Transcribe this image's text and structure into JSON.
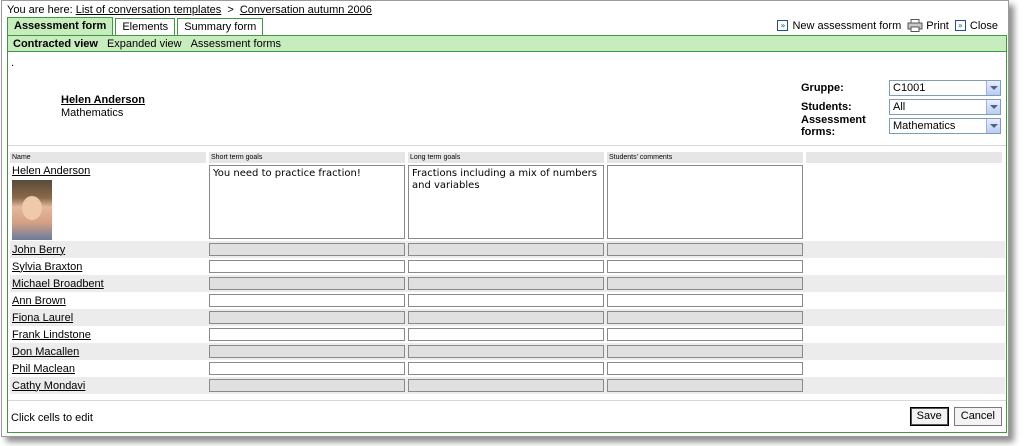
{
  "breadcrumb": {
    "prefix": "You are here:",
    "items": [
      "List of conversation templates",
      "Conversation autumn 2006"
    ],
    "separator": ">"
  },
  "tabs": [
    {
      "label": "Assessment form",
      "active": true
    },
    {
      "label": "Elements",
      "active": false
    },
    {
      "label": "Summary form",
      "active": false
    }
  ],
  "top_actions": {
    "new_form": "New assessment form",
    "print": "Print",
    "close": "Close"
  },
  "subnav": [
    {
      "label": "Contracted view",
      "active": true
    },
    {
      "label": "Expanded view",
      "active": false
    },
    {
      "label": "Assessment forms",
      "active": false
    }
  ],
  "dot": ".",
  "student": {
    "name": "Helen Anderson",
    "subject": "Mathematics"
  },
  "filters": [
    {
      "label": "Gruppe:",
      "value": "C1001"
    },
    {
      "label": "Students:",
      "value": "All"
    },
    {
      "label": "Assessment forms:",
      "value": "Mathematics"
    }
  ],
  "table": {
    "headers": [
      "Name",
      "Short term goals",
      "Long term goals",
      "Students' comments",
      ""
    ],
    "first_row": {
      "name": "Helen Anderson",
      "short_term": "You need to practice fraction!",
      "long_term": "Fractions including a mix of numbers and variables",
      "comments": ""
    },
    "rows": [
      "John Berry",
      "Sylvia Braxton",
      "Michael Broadbent",
      "Ann Brown",
      "Fiona Laurel",
      "Frank Lindstone",
      "Don Macallen",
      "Phil Maclean",
      "Cathy Mondavi"
    ]
  },
  "footer": {
    "hint": "Click cells to edit",
    "save": "Save",
    "cancel": "Cancel"
  },
  "colors": {
    "accent_green": "#3f9a3f",
    "tab_active_bg": "#c7ecbd"
  }
}
